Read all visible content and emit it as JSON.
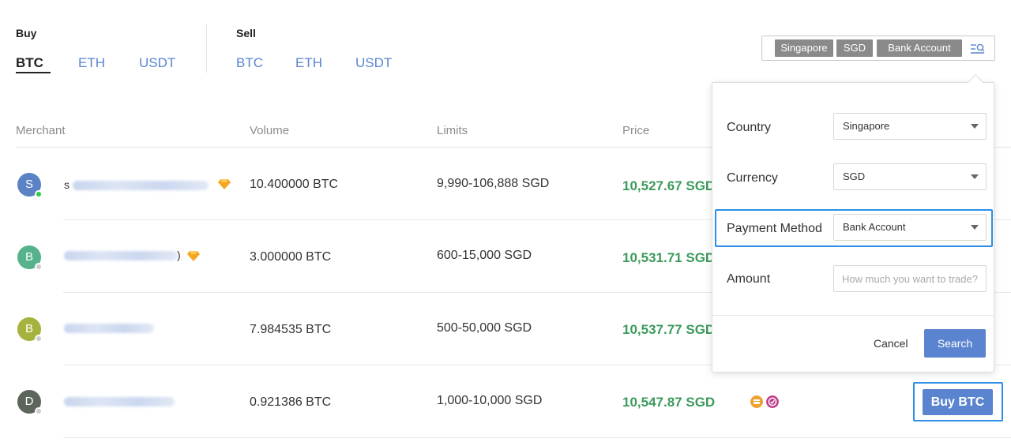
{
  "tabs": {
    "buy_label": "Buy",
    "sell_label": "Sell",
    "buy_coins": [
      "BTC",
      "ETH",
      "USDT"
    ],
    "sell_coins": [
      "BTC",
      "ETH",
      "USDT"
    ],
    "active": "Buy BTC"
  },
  "filters": {
    "country": "Singapore",
    "currency": "SGD",
    "payment_method": "Bank Account",
    "icon": "filter-search-icon"
  },
  "table": {
    "headers": {
      "merchant": "Merchant",
      "volume": "Volume",
      "limits": "Limits",
      "price": "Price"
    },
    "rows": [
      {
        "avatar_letter": "S",
        "avatar_color": "#5b82c4",
        "online": true,
        "name_prefix": "s",
        "verified_badge": true,
        "volume": "10.400000 BTC",
        "limits": "9,990-106,888 SGD",
        "price": "10,527.67 SGD"
      },
      {
        "avatar_letter": "B",
        "avatar_color": "#55b28a",
        "online": false,
        "name_prefix": "",
        "name_suffix": ")",
        "verified_badge": true,
        "volume": "3.000000 BTC",
        "limits": "600-15,000 SGD",
        "price": "10,531.71 SGD"
      },
      {
        "avatar_letter": "B",
        "avatar_color": "#a5b33e",
        "online": false,
        "name_prefix": "",
        "verified_badge": false,
        "volume": "7.984535 BTC",
        "limits": "500-50,000 SGD",
        "price": "10,537.77 SGD"
      },
      {
        "avatar_letter": "D",
        "avatar_color": "#5c655b",
        "online": false,
        "name_prefix": "",
        "verified_badge": false,
        "volume": "0.921386 BTC",
        "limits": "1,000-10,000 SGD",
        "price": "10,547.87 SGD"
      }
    ],
    "buy_button_label": "Buy BTC"
  },
  "colors": {
    "accent": "#5a84cf",
    "price_green": "#3d9a5d",
    "highlight": "#2f8ee6",
    "online": "#2ecc40",
    "offline": "#cccccc",
    "badge_orange": "#f0a030",
    "badge_pink": "#c03a8a"
  },
  "popover": {
    "country_label": "Country",
    "country_value": "Singapore",
    "currency_label": "Currency",
    "currency_value": "SGD",
    "payment_label": "Payment Method",
    "payment_value": "Bank Account",
    "amount_label": "Amount",
    "amount_placeholder": "How much you want to trade?",
    "cancel_label": "Cancel",
    "search_label": "Search"
  }
}
